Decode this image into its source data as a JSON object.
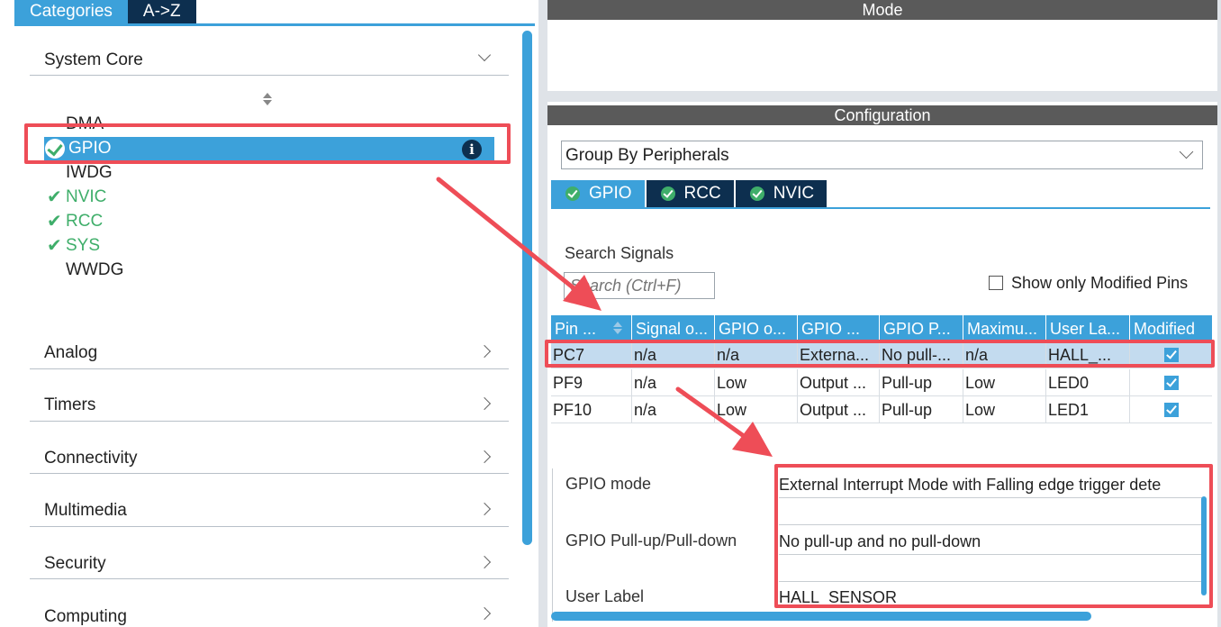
{
  "left": {
    "tabs": [
      "Categories",
      "A->Z"
    ],
    "system_core": {
      "label": "System Core",
      "items": [
        {
          "label": "DMA",
          "checked": false
        },
        {
          "label": "GPIO",
          "checked": true,
          "selected": true
        },
        {
          "label": "IWDG",
          "checked": false
        },
        {
          "label": "NVIC",
          "checked": true
        },
        {
          "label": "RCC",
          "checked": true
        },
        {
          "label": "SYS",
          "checked": true
        },
        {
          "label": "WWDG",
          "checked": false
        }
      ]
    },
    "categories": [
      "Analog",
      "Timers",
      "Connectivity",
      "Multimedia",
      "Security",
      "Computing"
    ]
  },
  "right": {
    "mode_title": "Mode",
    "config_title": "Configuration",
    "group_by": "Group By Peripherals",
    "peripheral_tabs": [
      "GPIO",
      "RCC",
      "NVIC"
    ],
    "search": {
      "label": "Search Signals",
      "placeholder": "Search (Ctrl+F)"
    },
    "show_modified": "Show only Modified Pins",
    "table": {
      "headers": [
        "Pin ...",
        "Signal o...",
        "GPIO o...",
        "GPIO ...",
        "GPIO P...",
        "Maximu...",
        "User La...",
        "Modified"
      ],
      "rows": [
        [
          "PC7",
          "n/a",
          "n/a",
          "Externa...",
          "No pull-...",
          "n/a",
          "HALL_...",
          true
        ],
        [
          "PF9",
          "n/a",
          "Low",
          "Output ...",
          "Pull-up",
          "Low",
          "LED0",
          true
        ],
        [
          "PF10",
          "n/a",
          "Low",
          "Output ...",
          "Pull-up",
          "Low",
          "LED1",
          true
        ]
      ]
    },
    "details": {
      "gpio_mode_label": "GPIO mode",
      "gpio_mode_value": "External Interrupt Mode with Falling edge trigger dete",
      "pull_label": "GPIO Pull-up/Pull-down",
      "pull_value": "No pull-up and no pull-down",
      "user_label_label": "User Label",
      "user_label_value": "HALL_SENSOR"
    }
  },
  "colors": {
    "accent": "#3ca1da",
    "dark_tab": "#0d2f4f",
    "section_header": "#5a5a5a",
    "check_green": "#3fae6a",
    "annotation_red": "#ee4d57"
  }
}
